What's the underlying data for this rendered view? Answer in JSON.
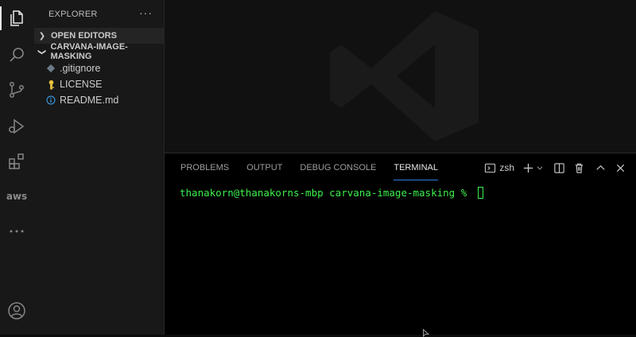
{
  "activity_bar": {
    "items": [
      {
        "icon": "files-icon"
      },
      {
        "icon": "search-icon"
      },
      {
        "icon": "source-control-icon"
      },
      {
        "icon": "run-debug-icon"
      },
      {
        "icon": "extensions-icon"
      },
      {
        "icon": "aws-icon",
        "label": "aws"
      },
      {
        "icon": "more-icon"
      },
      {
        "icon": "account-icon"
      }
    ]
  },
  "sidebar": {
    "title": "EXPLORER",
    "more": "···",
    "sections": {
      "open_editors": "OPEN EDITORS",
      "project": "CARVANA-IMAGE-MASKING"
    },
    "files": [
      {
        "name": ".gitignore",
        "icon": "git-icon",
        "color": "#6c7a89"
      },
      {
        "name": "LICENSE",
        "icon": "license-icon",
        "color": "#e8c33c"
      },
      {
        "name": "README.md",
        "icon": "info-icon",
        "color": "#3b9ee8"
      }
    ]
  },
  "panel": {
    "tabs": [
      "PROBLEMS",
      "OUTPUT",
      "DEBUG CONSOLE",
      "TERMINAL"
    ],
    "active_tab": "TERMINAL",
    "shell": "zsh",
    "terminal_prompt": "thanakorn@thanakorns-mbp carvana-image-masking % "
  },
  "colors": {
    "terminal_text": "#3ef04e",
    "accent": "#2f7de1"
  }
}
